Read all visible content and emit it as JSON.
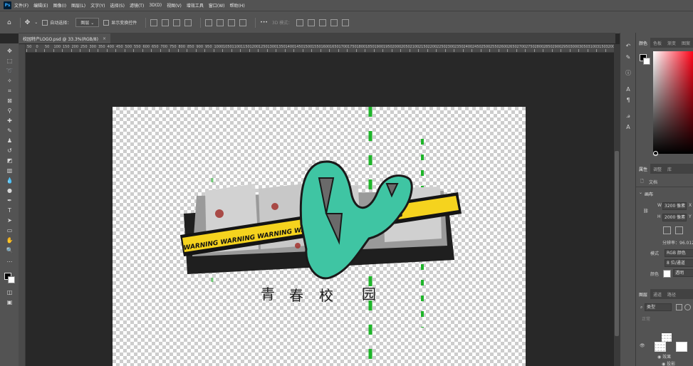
{
  "app": {
    "logo": "Ps"
  },
  "menu": [
    "文件(F)",
    "编辑(E)",
    "图像(I)",
    "图层(L)",
    "文字(Y)",
    "选择(S)",
    "滤镜(T)",
    "3D(D)",
    "视图(V)",
    "增效工具",
    "窗口(W)",
    "帮助(H)"
  ],
  "options": {
    "auto_select_label": "自动选择：",
    "auto_select_value": "图层",
    "transform_controls_label": "显示变换控件",
    "mode_3d_label": "3D 模式：",
    "more_label": "•••"
  },
  "document": {
    "tab_title": "校园特产LOGO.psd @ 33.3%(RGB/8)",
    "close": "×"
  },
  "ruler_top_ticks": [
    "50",
    "0",
    "50",
    "100",
    "150",
    "200",
    "250",
    "300",
    "350",
    "400",
    "450",
    "500",
    "550",
    "600",
    "650",
    "700",
    "750",
    "800",
    "850",
    "900",
    "950",
    "1000",
    "1050",
    "1100",
    "1150",
    "1200",
    "1250",
    "1300",
    "1350",
    "1400",
    "1450",
    "1500",
    "1550",
    "1600",
    "1650",
    "1700",
    "1750",
    "1800",
    "1850",
    "1900",
    "1950",
    "2000",
    "2050",
    "2100",
    "2150",
    "2200",
    "2250",
    "2300",
    "2350",
    "2400",
    "2450",
    "2500",
    "2550",
    "2600",
    "2650",
    "2700",
    "2750",
    "2800",
    "2850",
    "2900",
    "2950",
    "3000",
    "3050",
    "3100",
    "3150",
    "3200",
    "3250",
    "3300"
  ],
  "logo_art": {
    "banner_text": "WARNING WARNING WARNING WARNING WARNING WARNING",
    "subtitle_chars": [
      "青",
      "春",
      "校",
      "园"
    ]
  },
  "panels": {
    "color_tabs": [
      "颜色",
      "色板",
      "渐变",
      "图案"
    ],
    "props_tabs": [
      "属性",
      "调整",
      "库"
    ],
    "props": {
      "doc_label": "文档",
      "canvas_label": "画布",
      "w_label": "W",
      "w_value": "3200 像素",
      "x_label": "X",
      "h_label": "H",
      "h_value": "2000 像素",
      "y_label": "Y",
      "resolution": "分辨率：96.012",
      "mode_label": "模式",
      "mode_value": "RGB 颜色",
      "depth_value": "8 位/通道",
      "bg_label": "颜色",
      "bg_value": "透明"
    },
    "layers_tabs": [
      "图层",
      "通道",
      "路径"
    ],
    "layers": {
      "filter_label": "类型",
      "blend_mode": "正常",
      "effect_label": "效果",
      "shadow_label": "投影"
    }
  },
  "colors": {
    "accent_green": "#1fb52a",
    "banner_yellow": "#f5d31e",
    "teal": "#3fc5a3"
  }
}
